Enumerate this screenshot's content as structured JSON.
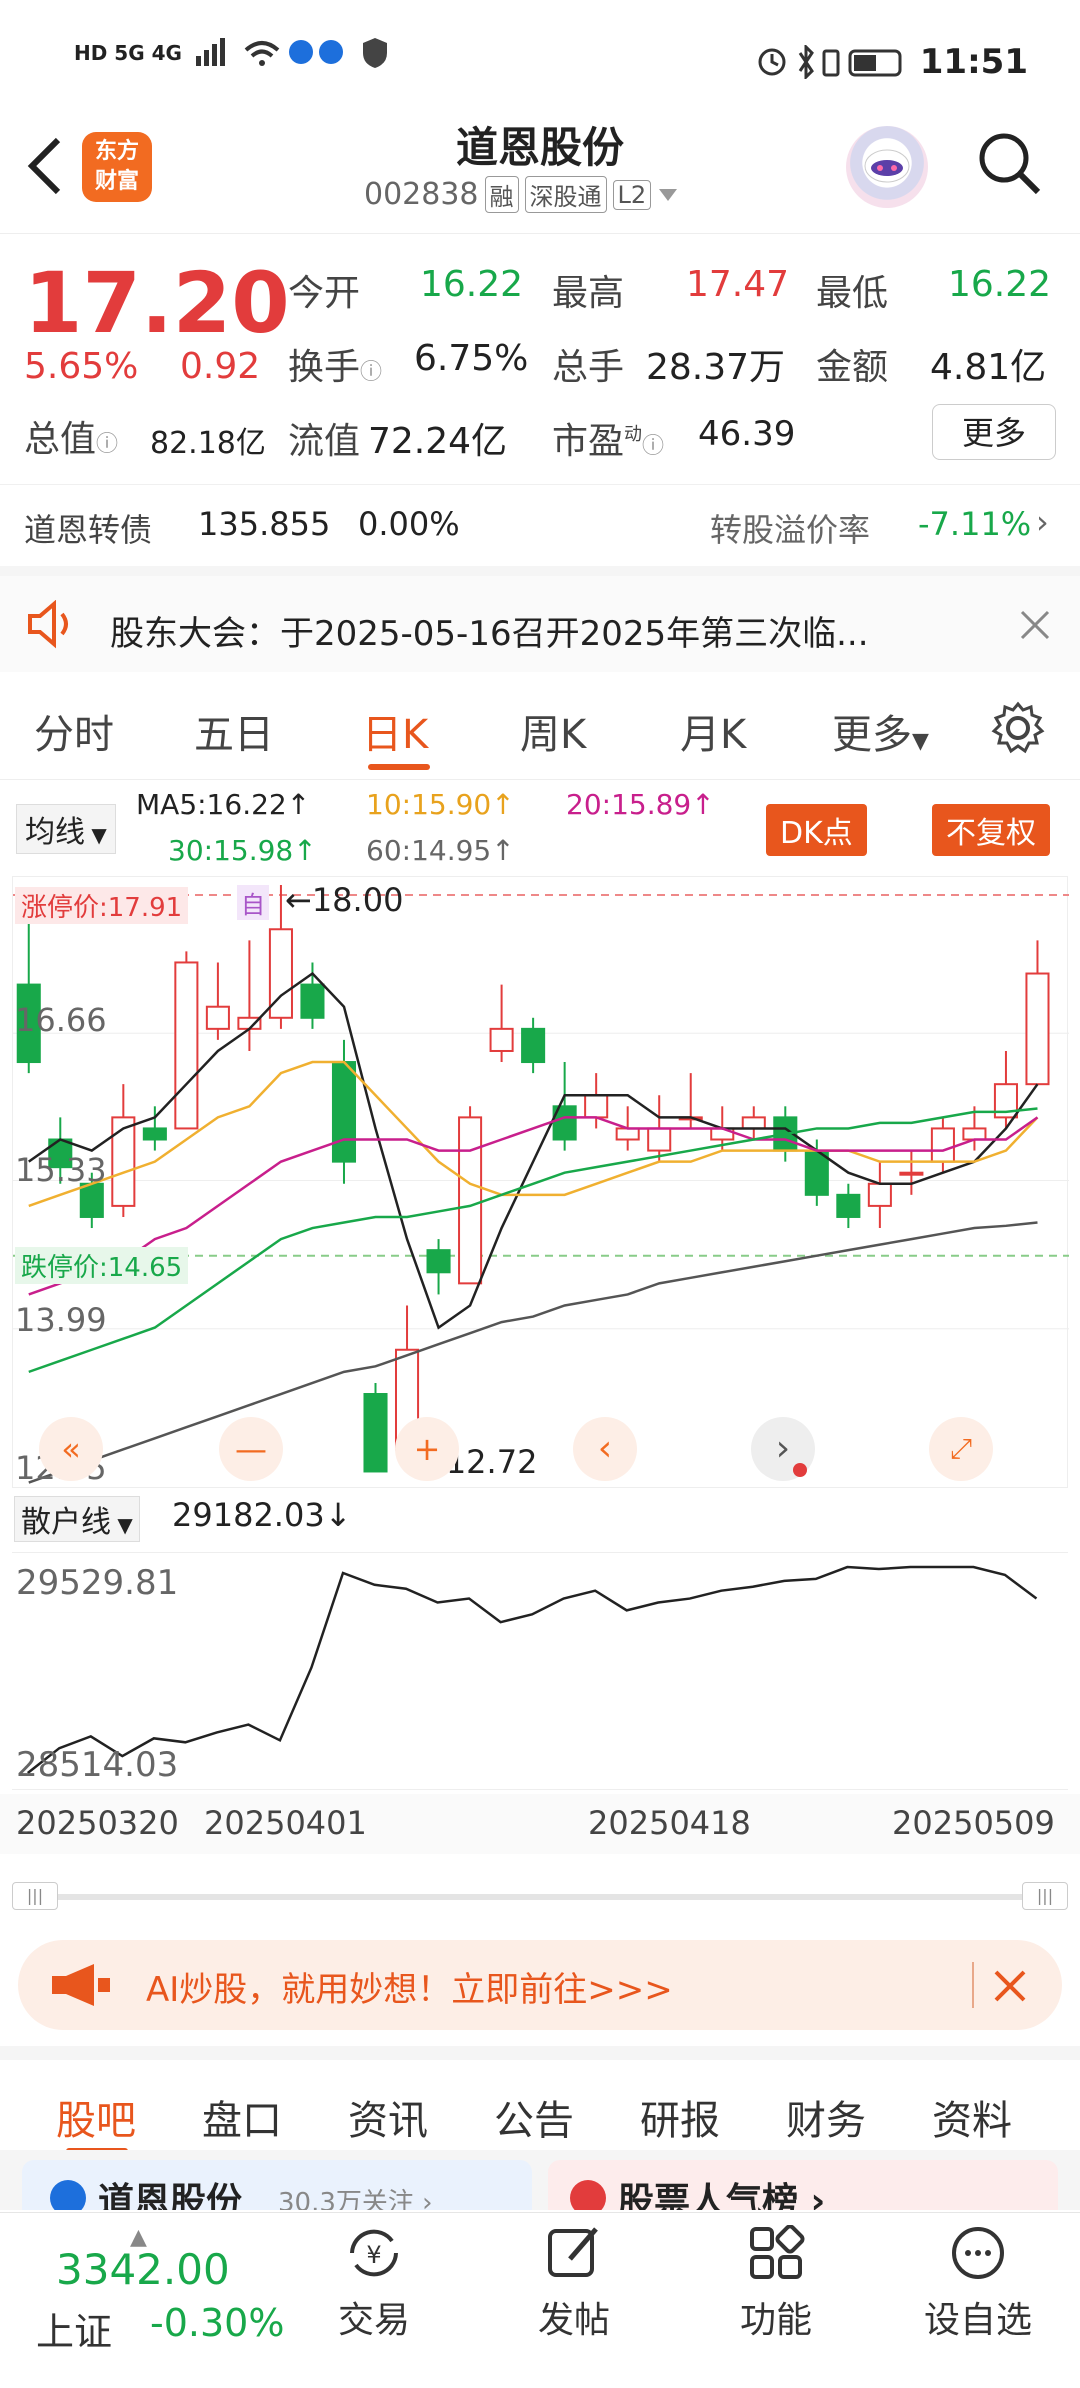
{
  "status_bar": {
    "left": "HD 5G 4G",
    "time": "11:51"
  },
  "header": {
    "title": "道恩股份",
    "code": "002838",
    "tags": [
      "融",
      "深股通",
      "L2"
    ],
    "logo": "东方\n财富"
  },
  "quote": {
    "price": "17.20",
    "change_pct": "5.65%",
    "change": "0.92",
    "open_label": "今开",
    "open": "16.22",
    "high_label": "最高",
    "high": "17.47",
    "low_label": "最低",
    "low": "16.22",
    "turnover_label": "换手",
    "turnover": "6.75%",
    "volume_label": "总手",
    "volume": "28.37万",
    "amount_label": "金额",
    "amount": "4.81亿",
    "mktcap_label": "总值",
    "mktcap": "82.18亿",
    "float_label": "流值",
    "float": "72.24亿",
    "pe_label": "市盈",
    "pe_sup": "动",
    "pe": "46.39",
    "more": "更多"
  },
  "convertible": {
    "name": "道恩转债",
    "price": "135.855",
    "pct": "0.00%",
    "premium_label": "转股溢价率",
    "premium": "-7.11%"
  },
  "notice": {
    "text": "股东大会：于2025-05-16召开2025年第三次临..."
  },
  "chart_tabs": [
    "分时",
    "五日",
    "日K",
    "周K",
    "月K",
    "更多"
  ],
  "active_chart_tab": "日K",
  "ma": {
    "selector": "均线",
    "ma5": "MA5:16.22↑",
    "ma10": "10:15.90↑",
    "ma20": "20:15.89↑",
    "ma30": "30:15.98↑",
    "ma60": "60:14.95↑",
    "dk": "DK点",
    "adj": "不复权"
  },
  "chart": {
    "limit_up": "涨停价:17.91",
    "limit_down": "跌停价:14.65",
    "y_labels": [
      "18.00",
      "16.66",
      "15.33",
      "13.99",
      "12.65"
    ],
    "high_mark": "←18.00",
    "low_mark": "←12.72",
    "self_tag": "自"
  },
  "sub": {
    "selector": "散户线",
    "value": "29182.03↓",
    "top": "29529.81",
    "bottom": "28514.03"
  },
  "dates": [
    "20250320",
    "20250401",
    "20250418",
    "20250509"
  ],
  "ai_banner": "AI炒股，就用妙想！立即前往>>>",
  "bottom_tabs": [
    "股吧",
    "盘口",
    "资讯",
    "公告",
    "研报",
    "财务",
    "资料"
  ],
  "cards": {
    "left": "道恩股份",
    "left_sub": "30.3万关注 ›",
    "right": "股票人气榜 ›"
  },
  "footer": {
    "index_value": "3342.00",
    "index_name": "上证",
    "index_pct": "-0.30%",
    "items": [
      "交易",
      "发帖",
      "功能",
      "设自选"
    ]
  },
  "colors": {
    "up": "#e23c3c",
    "down": "#18a84a",
    "accent": "#e8561d"
  },
  "chart_data": {
    "type": "candlestick",
    "candles": [
      {
        "o": 17.1,
        "c": 16.4,
        "h": 17.9,
        "l": 16.3
      },
      {
        "o": 15.7,
        "c": 15.45,
        "h": 15.9,
        "l": 15.3
      },
      {
        "o": 15.3,
        "c": 15.0,
        "h": 15.4,
        "l": 14.9
      },
      {
        "o": 15.1,
        "c": 15.9,
        "h": 16.2,
        "l": 15.0
      },
      {
        "o": 15.8,
        "c": 15.7,
        "h": 16.0,
        "l": 15.6
      },
      {
        "o": 15.8,
        "c": 17.3,
        "h": 17.4,
        "l": 15.8
      },
      {
        "o": 16.7,
        "c": 16.9,
        "h": 17.3,
        "l": 16.6
      },
      {
        "o": 16.7,
        "c": 16.8,
        "h": 17.5,
        "l": 16.5
      },
      {
        "o": 16.8,
        "c": 17.6,
        "h": 18.0,
        "l": 16.7
      },
      {
        "o": 17.1,
        "c": 16.8,
        "h": 17.3,
        "l": 16.7
      },
      {
        "o": 16.4,
        "c": 15.5,
        "h": 16.6,
        "l": 15.3
      },
      {
        "o": 13.4,
        "c": 12.7,
        "h": 13.5,
        "l": 12.7
      },
      {
        "o": 12.9,
        "c": 13.8,
        "h": 14.2,
        "l": 12.7
      },
      {
        "o": 14.7,
        "c": 14.5,
        "h": 14.8,
        "l": 14.3
      },
      {
        "o": 14.4,
        "c": 15.9,
        "h": 16.0,
        "l": 14.4
      },
      {
        "o": 16.5,
        "c": 16.7,
        "h": 17.1,
        "l": 16.4
      },
      {
        "o": 16.7,
        "c": 16.4,
        "h": 16.8,
        "l": 16.3
      },
      {
        "o": 16.0,
        "c": 15.7,
        "h": 16.4,
        "l": 15.6
      },
      {
        "o": 15.9,
        "c": 16.1,
        "h": 16.3,
        "l": 15.8
      },
      {
        "o": 15.7,
        "c": 15.8,
        "h": 16.0,
        "l": 15.6
      },
      {
        "o": 15.6,
        "c": 15.8,
        "h": 16.1,
        "l": 15.5
      },
      {
        "o": 15.9,
        "c": 15.9,
        "h": 16.3,
        "l": 15.8
      },
      {
        "o": 15.7,
        "c": 15.8,
        "h": 16.0,
        "l": 15.6
      },
      {
        "o": 15.8,
        "c": 15.9,
        "h": 16.0,
        "l": 15.7
      },
      {
        "o": 15.9,
        "c": 15.6,
        "h": 16.0,
        "l": 15.5
      },
      {
        "o": 15.6,
        "c": 15.2,
        "h": 15.7,
        "l": 15.1
      },
      {
        "o": 15.2,
        "c": 15.0,
        "h": 15.3,
        "l": 14.9
      },
      {
        "o": 15.1,
        "c": 15.3,
        "h": 15.5,
        "l": 14.9
      },
      {
        "o": 15.4,
        "c": 15.4,
        "h": 15.6,
        "l": 15.2
      },
      {
        "o": 15.5,
        "c": 15.8,
        "h": 15.9,
        "l": 15.4
      },
      {
        "o": 15.7,
        "c": 15.8,
        "h": 16.0,
        "l": 15.6
      },
      {
        "o": 15.9,
        "c": 16.2,
        "h": 16.5,
        "l": 15.8
      },
      {
        "o": 16.2,
        "c": 17.2,
        "h": 17.5,
        "l": 16.2
      }
    ],
    "ma5": [
      15.5,
      15.7,
      15.6,
      15.8,
      15.9,
      16.2,
      16.5,
      16.7,
      17.0,
      17.2,
      16.9,
      15.8,
      14.8,
      14.0,
      14.2,
      14.9,
      15.5,
      16.1,
      16.1,
      16.1,
      15.9,
      15.9,
      15.8,
      15.8,
      15.8,
      15.6,
      15.4,
      15.3,
      15.3,
      15.4,
      15.5,
      15.8,
      16.2
    ],
    "ma10": [
      15.1,
      15.2,
      15.3,
      15.4,
      15.5,
      15.7,
      15.9,
      16.0,
      16.3,
      16.4,
      16.4,
      16.1,
      15.8,
      15.5,
      15.3,
      15.2,
      15.2,
      15.2,
      15.3,
      15.4,
      15.5,
      15.5,
      15.6,
      15.6,
      15.6,
      15.6,
      15.6,
      15.5,
      15.5,
      15.5,
      15.5,
      15.6,
      15.9
    ],
    "ma20": [
      14.3,
      14.4,
      14.5,
      14.6,
      14.8,
      14.9,
      15.1,
      15.3,
      15.5,
      15.6,
      15.7,
      15.7,
      15.7,
      15.6,
      15.6,
      15.7,
      15.8,
      15.9,
      15.9,
      15.8,
      15.8,
      15.8,
      15.8,
      15.7,
      15.7,
      15.6,
      15.6,
      15.6,
      15.6,
      15.6,
      15.7,
      15.7,
      15.9
    ],
    "ma30": [
      13.6,
      13.7,
      13.8,
      13.9,
      14.0,
      14.2,
      14.4,
      14.6,
      14.8,
      14.9,
      14.95,
      15.0,
      15.0,
      15.05,
      15.1,
      15.2,
      15.3,
      15.4,
      15.45,
      15.5,
      15.55,
      15.6,
      15.65,
      15.7,
      15.75,
      15.8,
      15.8,
      15.85,
      15.85,
      15.9,
      15.95,
      15.95,
      15.98
    ],
    "ma60": [
      12.6,
      12.7,
      12.8,
      12.9,
      13.0,
      13.1,
      13.2,
      13.3,
      13.4,
      13.5,
      13.6,
      13.65,
      13.75,
      13.85,
      13.95,
      14.05,
      14.1,
      14.2,
      14.25,
      14.3,
      14.4,
      14.45,
      14.5,
      14.55,
      14.6,
      14.65,
      14.7,
      14.75,
      14.8,
      14.85,
      14.9,
      14.92,
      14.95
    ],
    "ylim": [
      12.65,
      18.0
    ],
    "limit_up": 17.91,
    "limit_down": 14.65,
    "sub_series": [
      28514,
      28640,
      28700,
      28600,
      28690,
      28670,
      28720,
      28760,
      28680,
      29050,
      29530,
      29470,
      29450,
      29380,
      29400,
      29280,
      29320,
      29400,
      29440,
      29340,
      29380,
      29400,
      29440,
      29460,
      29490,
      29500,
      29560,
      29550,
      29560,
      29560,
      29560,
      29520,
      29400
    ],
    "sub_ylim": [
      28514.03,
      29529.81
    ]
  }
}
